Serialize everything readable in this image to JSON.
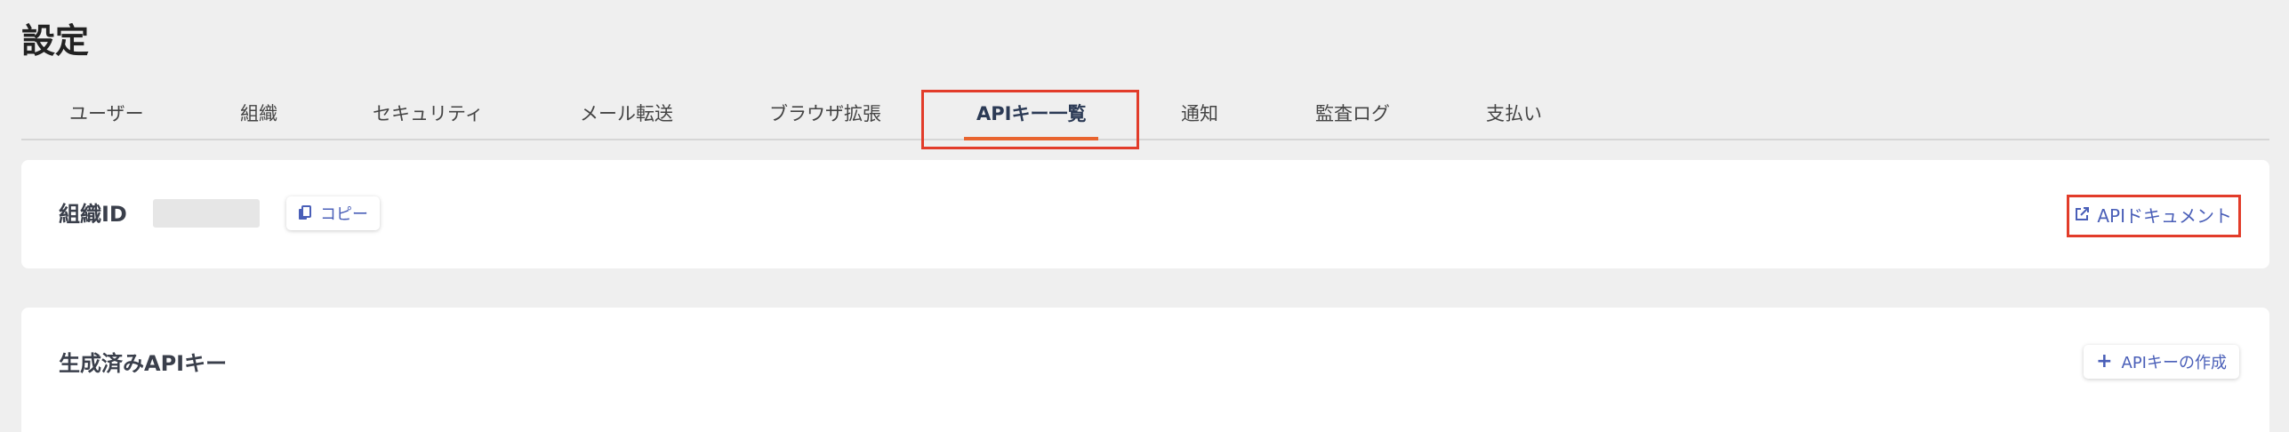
{
  "page": {
    "title": "設定"
  },
  "tabs": [
    {
      "label": "ユーザー",
      "active": false
    },
    {
      "label": "組織",
      "active": false
    },
    {
      "label": "セキュリティ",
      "active": false
    },
    {
      "label": "メール転送",
      "active": false
    },
    {
      "label": "ブラウザ拡張",
      "active": false
    },
    {
      "label": "APIキー一覧",
      "active": true
    },
    {
      "label": "通知",
      "active": false
    },
    {
      "label": "監査ログ",
      "active": false
    },
    {
      "label": "支払い",
      "active": false
    }
  ],
  "org_card": {
    "label": "組織ID",
    "org_id_value": "",
    "copy_label": "コピー",
    "api_docs_label": "APIドキュメント"
  },
  "keys_card": {
    "title": "生成済みAPIキー",
    "create_label": "APIキーの作成"
  },
  "icons": {
    "copy": "copy-icon",
    "external_link": "external-link-icon",
    "plus": "plus-icon"
  },
  "colors": {
    "accent_underline": "#e8642f",
    "link_blue": "#4a5fb8",
    "highlight_red": "#e23c2a"
  }
}
